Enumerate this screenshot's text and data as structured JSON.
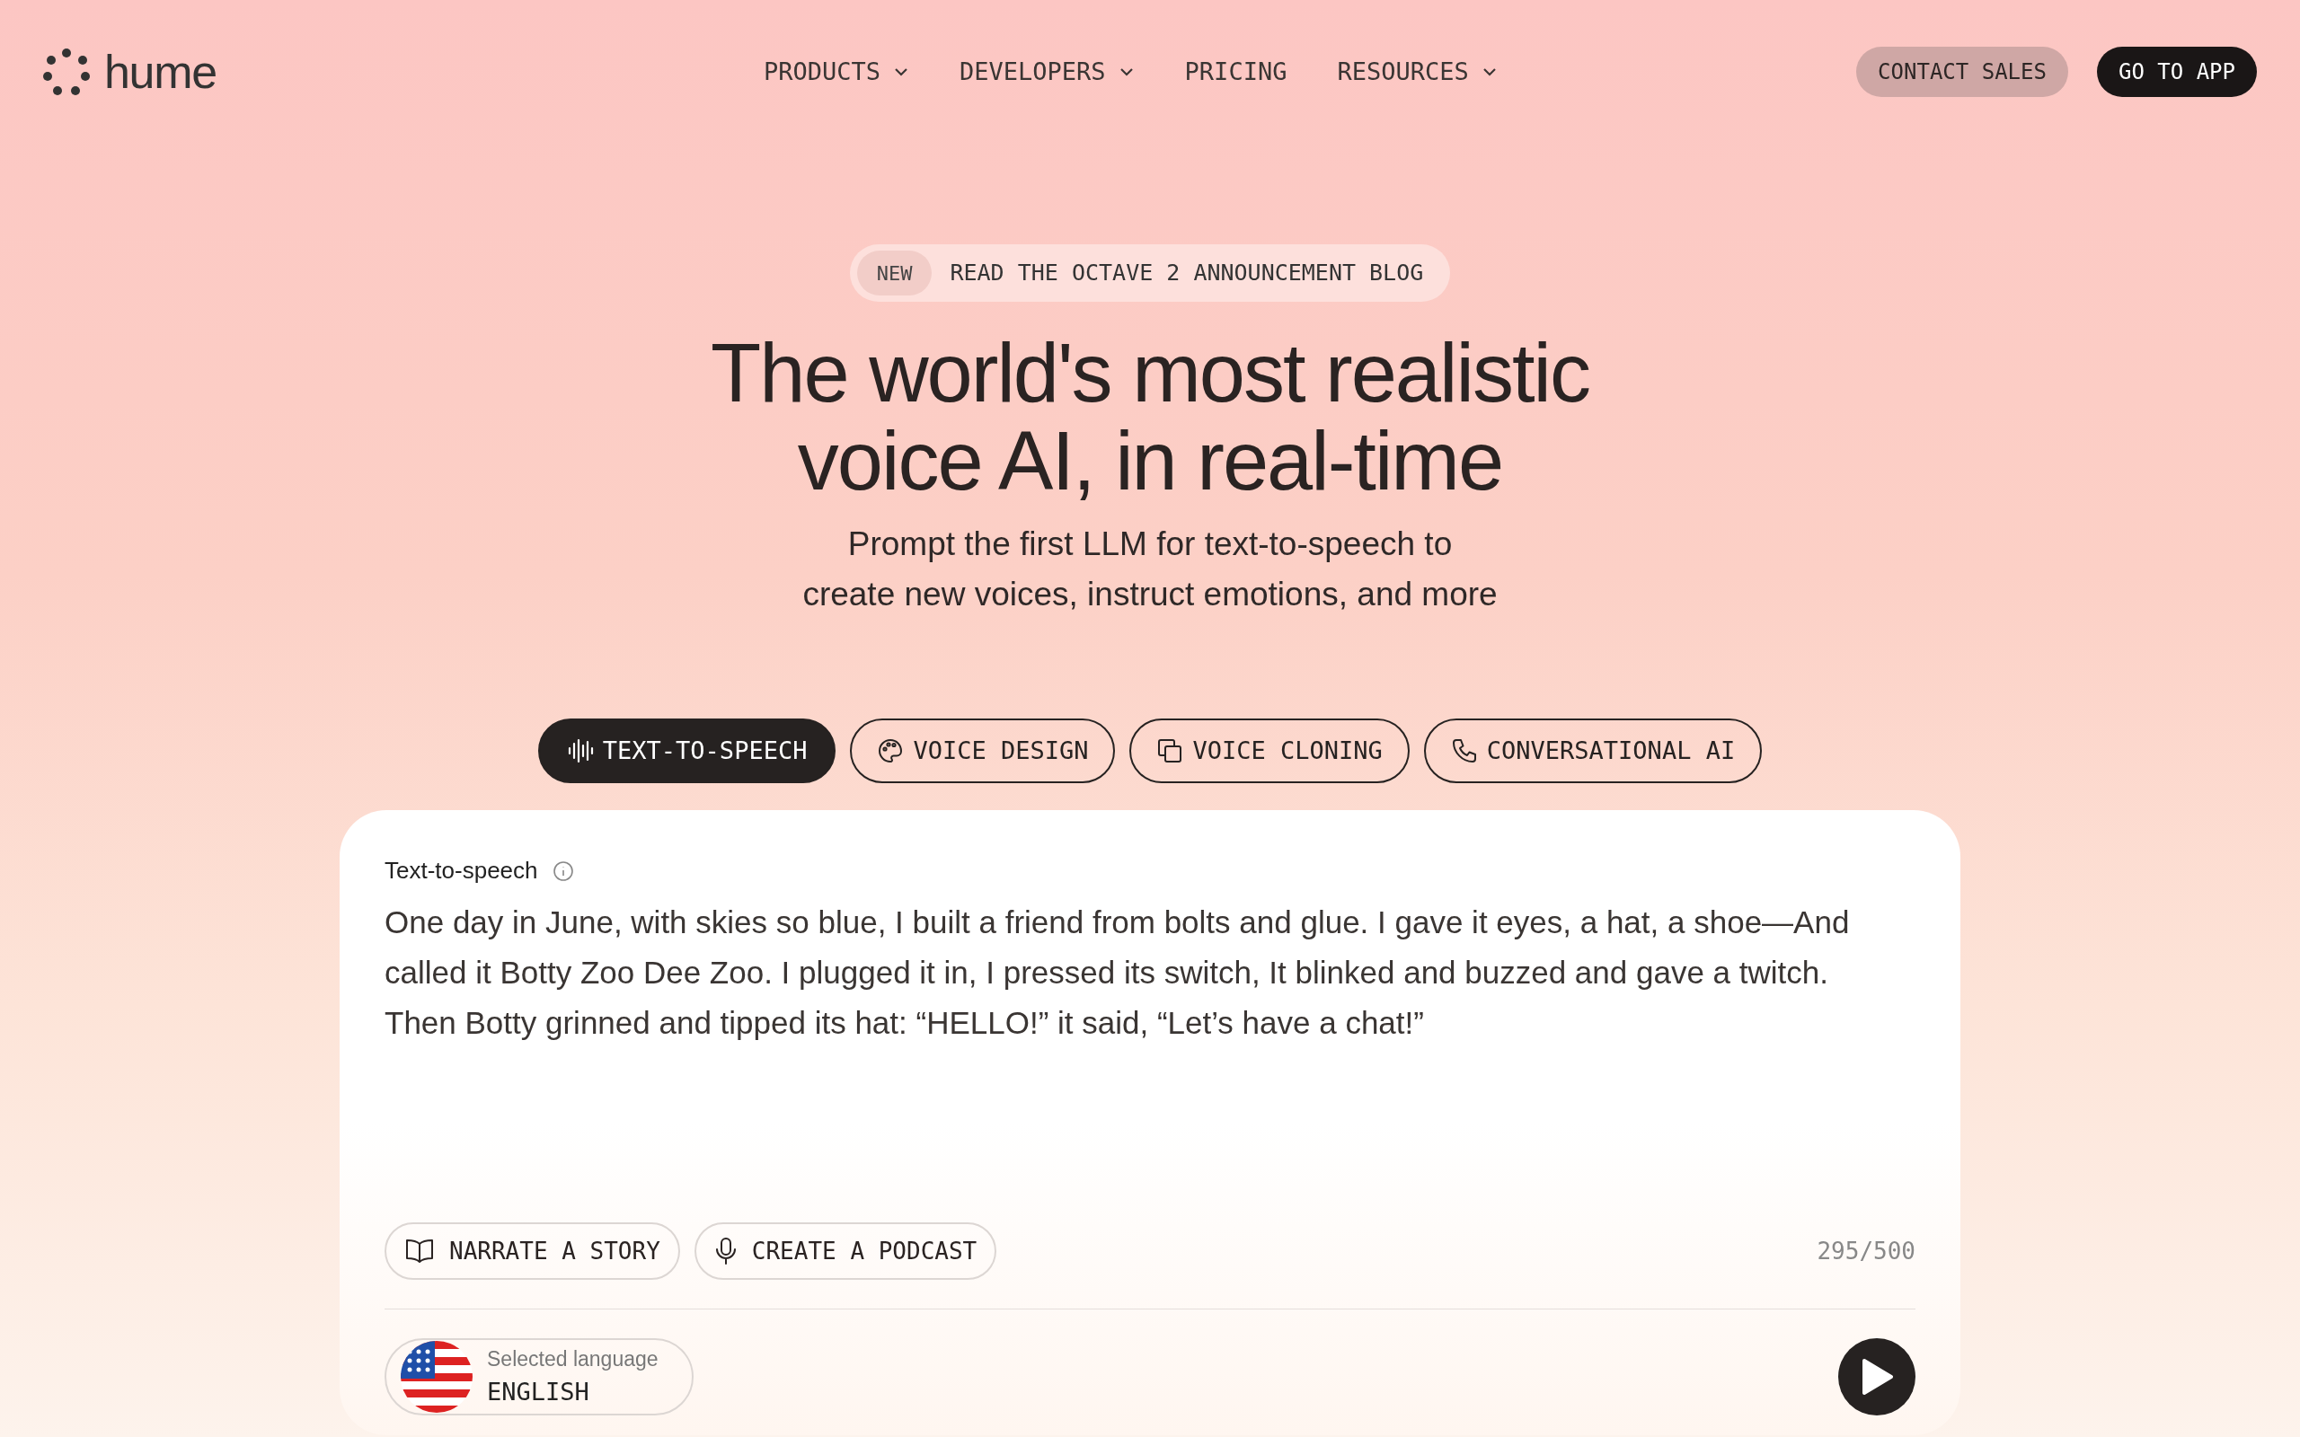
{
  "logo": {
    "text": "hume"
  },
  "nav": [
    {
      "label": "PRODUCTS",
      "dropdown": true
    },
    {
      "label": "DEVELOPERS",
      "dropdown": true
    },
    {
      "label": "PRICING",
      "dropdown": false
    },
    {
      "label": "RESOURCES",
      "dropdown": true
    }
  ],
  "header_buttons": [
    {
      "label": "CONTACT SALES",
      "kind": "secondary"
    },
    {
      "label": "GO TO APP",
      "kind": "primary"
    }
  ],
  "announcement": {
    "badge": "NEW",
    "text": "READ THE OCTAVE 2 ANNOUNCEMENT BLOG"
  },
  "hero": {
    "title_lines": [
      "The world's most realistic",
      "voice AI, in real-time"
    ],
    "subtitle_lines": [
      "Prompt the first LLM for text-to-speech to",
      "create new voices, instruct emotions, and more"
    ]
  },
  "tabs": [
    {
      "label": "TEXT-TO-SPEECH",
      "kind": "waveform",
      "selected": true
    },
    {
      "label": "VOICE DESIGN",
      "kind": "palette",
      "selected": false
    },
    {
      "label": "VOICE CLONING",
      "kind": "copy",
      "selected": false
    },
    {
      "label": "CONVERSATIONAL AI",
      "kind": "phone",
      "selected": false
    }
  ],
  "panel": {
    "label": "Text-to-speech",
    "text": "One day in June, with skies so blue, I built a friend from bolts and glue. I gave it eyes, a hat, a shoe—And called it Botty Zoo Dee Zoo. I plugged it in, I pressed its switch, It blinked and buzzed and gave a twitch. Then Botty grinned and tipped its hat: “HELLO!” it said, “Let’s have a chat!”",
    "presets": [
      {
        "label": "NARRATE A STORY",
        "kind": "book"
      },
      {
        "label": "CREATE A PODCAST",
        "kind": "mic"
      }
    ],
    "counter": "295/500",
    "language": {
      "caption": "Selected language",
      "value": "ENGLISH"
    }
  }
}
